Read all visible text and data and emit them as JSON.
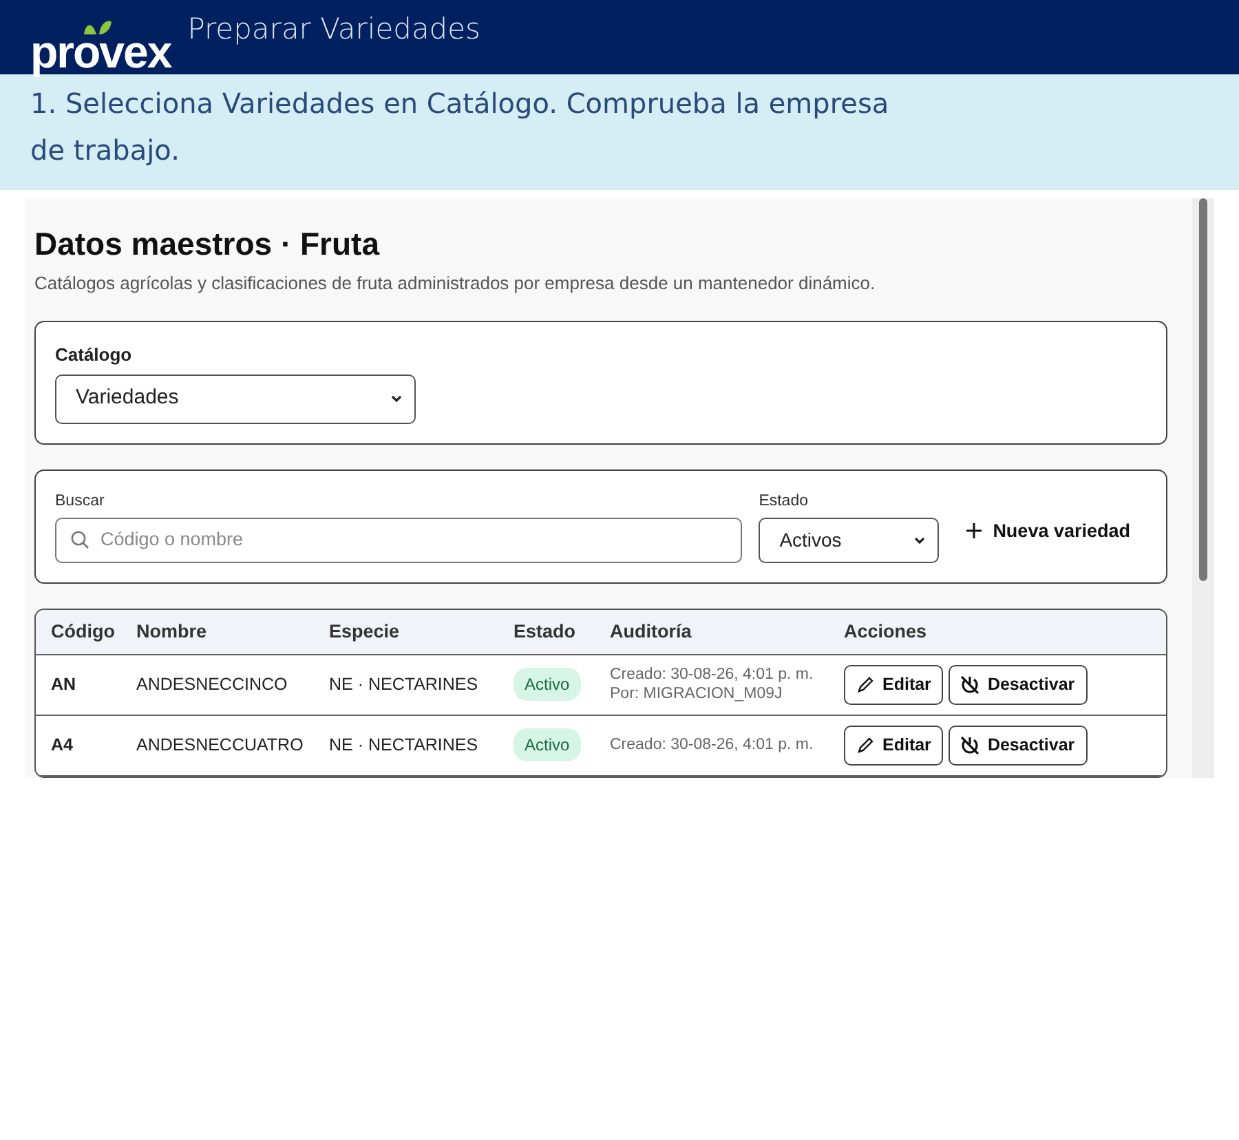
{
  "header": {
    "logo": "provex",
    "title": "Preparar Variedades"
  },
  "instruction": "1. Selecciona Variedades en Catálogo. Comprueba la empresa de trabajo.",
  "screenshot": {
    "title": "Datos maestros · Fruta",
    "subtitle": "Catálogos agrícolas y clasificaciones de fruta administrados por empresa desde un mantenedor dinámico.",
    "catalog": {
      "label": "Catálogo",
      "value": "Variedades"
    },
    "search": {
      "label": "Buscar",
      "placeholder": "Código o nombre"
    },
    "status_filter": {
      "label": "Estado",
      "value": "Activos"
    },
    "new_button": "Nueva variedad",
    "table": {
      "columns": [
        "Código",
        "Nombre",
        "Especie",
        "Estado",
        "Auditoría",
        "Acciones"
      ],
      "rows": [
        {
          "code": "AN",
          "name": "ANDESNECCINCO",
          "species": "NE · NECTARINES",
          "status": "Activo",
          "audit": [
            "Creado: 30-08-26, 4:01 p. m.",
            "Por: MIGRACION_M09J"
          ],
          "actions": [
            "Editar",
            "Desactivar"
          ]
        },
        {
          "code": "A4",
          "name": "ANDESNECCUATRO",
          "species": "NE · NECTARINES",
          "status": "Activo",
          "audit": [
            "Creado: 30-08-26, 4:01 p. m."
          ],
          "actions": [
            "Editar",
            "Desactivar"
          ]
        }
      ]
    }
  }
}
